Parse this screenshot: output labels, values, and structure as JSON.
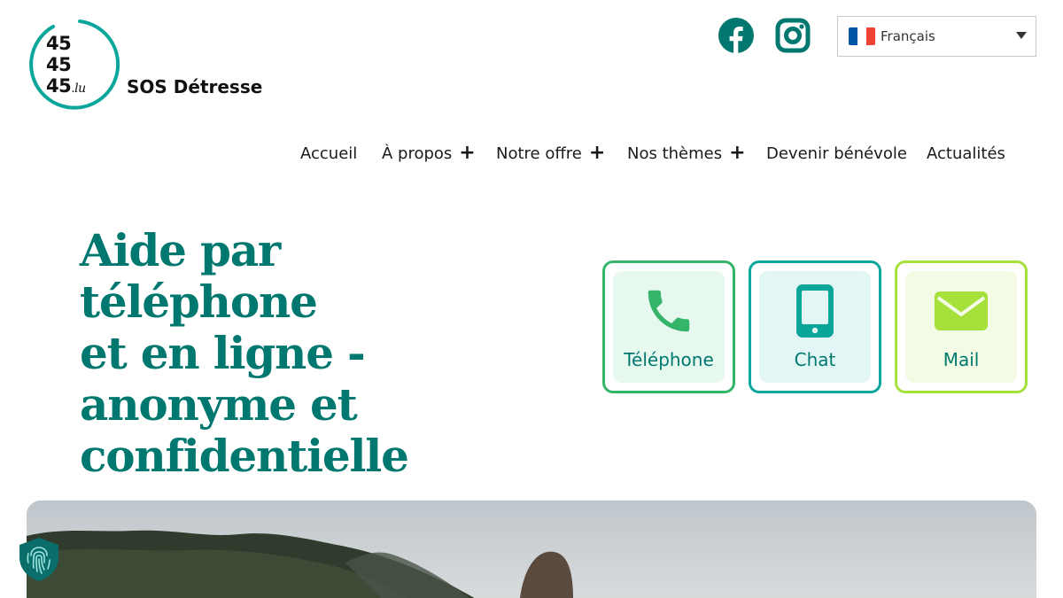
{
  "logo": {
    "numbers": [
      "45",
      "45",
      "45"
    ],
    "suffix": ".lu",
    "name": "SOS Détresse"
  },
  "social": [
    {
      "icon": "facebook-icon"
    },
    {
      "icon": "instagram-icon"
    }
  ],
  "language": {
    "selected": "Français",
    "flag_colors": [
      "#0055a4",
      "#ffffff",
      "#ef4135"
    ]
  },
  "nav": {
    "items": [
      {
        "label": "Accueil",
        "has_submenu": false
      },
      {
        "label": "À propos",
        "has_submenu": true
      },
      {
        "label": "Notre offre",
        "has_submenu": true
      },
      {
        "label": "Nos thèmes",
        "has_submenu": true
      },
      {
        "label": "Devenir bénévole",
        "has_submenu": false
      },
      {
        "label": "Actualités",
        "has_submenu": false
      }
    ],
    "submenu_symbol": "+"
  },
  "hero": {
    "title_lines": [
      "Aide par téléphone",
      "et en ligne -",
      "anonyme et",
      "confidentielle"
    ]
  },
  "contact": [
    {
      "label": "Téléphone",
      "icon": "phone-icon",
      "color": "#35b56a"
    },
    {
      "label": "Chat",
      "icon": "smartphone-icon",
      "color": "#0aa69c"
    },
    {
      "label": "Mail",
      "icon": "envelope-icon",
      "color": "#a6e03b"
    }
  ],
  "colors": {
    "brand_teal": "#00786f",
    "logo_ring": "#0aa69c"
  }
}
